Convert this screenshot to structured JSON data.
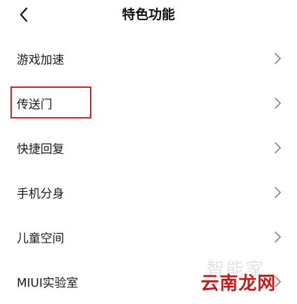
{
  "header": {
    "title": "特色功能",
    "back_icon": "chevron-left-icon"
  },
  "menu": {
    "items": [
      {
        "label": "游戏加速",
        "icon": "chevron-right-icon"
      },
      {
        "label": "传送门",
        "icon": "chevron-right-icon"
      },
      {
        "label": "快捷回复",
        "icon": "chevron-right-icon"
      },
      {
        "label": "手机分身",
        "icon": "chevron-right-icon"
      },
      {
        "label": "儿童空间",
        "icon": "chevron-right-icon"
      },
      {
        "label": "MIUI实验室",
        "icon": "chevron-right-icon"
      }
    ]
  },
  "annotation": {
    "highlight_color": "#d81e1e"
  },
  "watermark": {
    "faint": "智能家",
    "solid": "云南龙网"
  }
}
